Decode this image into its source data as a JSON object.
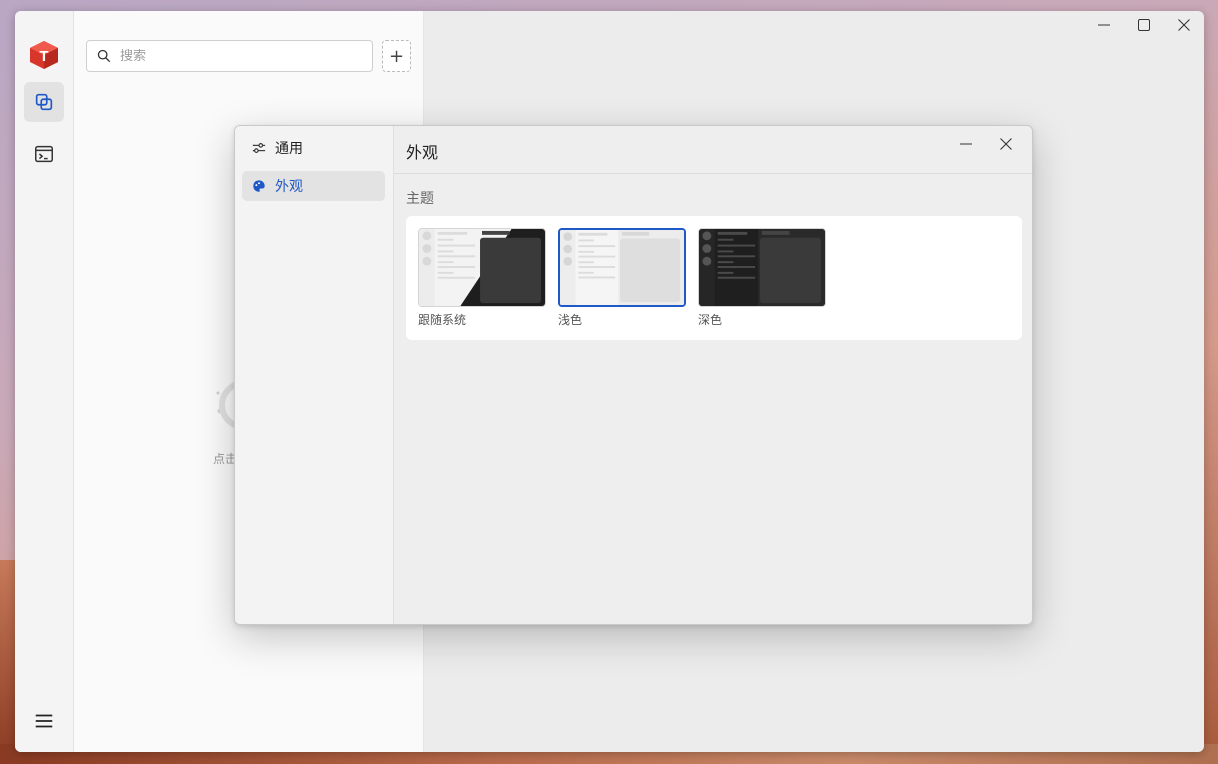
{
  "sidebar_rail": {
    "items": [
      {
        "name": "connections",
        "icon": "copy-stack-icon",
        "active": true
      },
      {
        "name": "terminal",
        "icon": "terminal-icon",
        "active": false
      }
    ],
    "menu_icon": "hamburger-menu-icon",
    "logo_icon": "red-cube-t-logo"
  },
  "list_pane": {
    "search": {
      "placeholder": "搜索",
      "value": ""
    },
    "add_button_label": "+",
    "empty_hint": "点击"
  },
  "settings_dialog": {
    "nav": [
      {
        "label": "通用",
        "icon": "sliders-icon",
        "active": false
      },
      {
        "label": "外观",
        "icon": "palette-icon",
        "active": true
      }
    ],
    "title": "外观",
    "section_label": "主题",
    "themes": [
      {
        "label": "跟随系统",
        "selected": false
      },
      {
        "label": "浅色",
        "selected": true
      },
      {
        "label": "深色",
        "selected": false
      }
    ]
  },
  "colors": {
    "accent": "#1f58c7",
    "logo_red": "#d9362b"
  }
}
